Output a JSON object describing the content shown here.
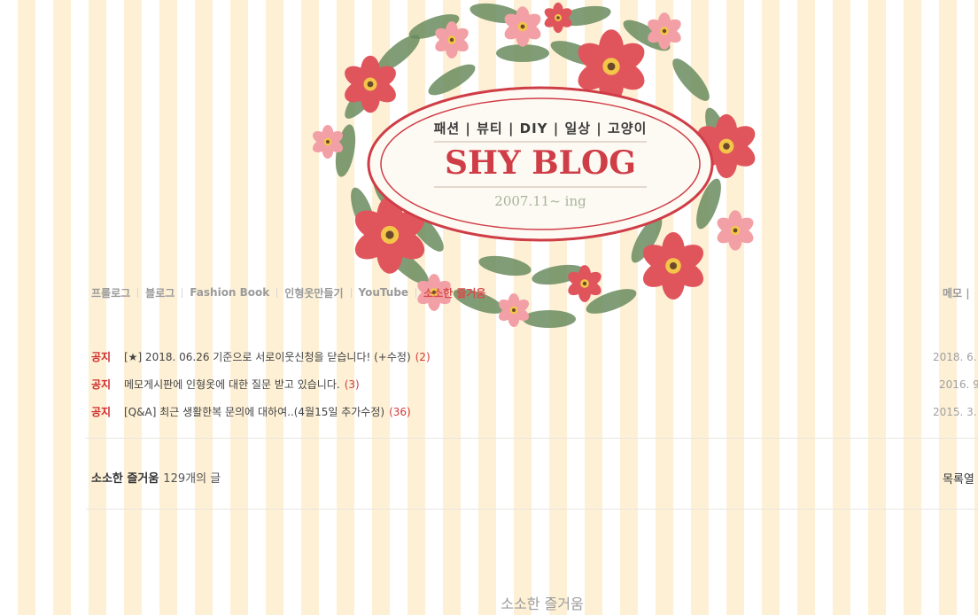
{
  "banner": {
    "categories": "패션 | 뷰티 | DIY | 일상 | 고양이",
    "title": "SHY BLOG",
    "date": "2007.11~ ing",
    "colors": {
      "title": "#cf3d47",
      "flower_main": "#e0555c",
      "flower_light": "#f2a0a6",
      "leaf": "#6b8c5f"
    }
  },
  "nav": {
    "items": [
      "프롤로그",
      "블로그",
      "Fashion Book",
      "인형옷만들기",
      "YouTube",
      "소소한 즐거움"
    ],
    "active_index": 5,
    "right_item": "메모 |"
  },
  "notices": [
    {
      "tag": "공지",
      "title": "[★] 2018. 06.26 기준으로 서로이웃신청을 닫습니다! (+수정)",
      "count": "(2)",
      "date": "2018. 6."
    },
    {
      "tag": "공지",
      "title": "메모게시판에 인형옷에 대한 질문 받고 있습니다.",
      "count": "(3)",
      "date": "2016. 9"
    },
    {
      "tag": "공지",
      "title": "[Q&A] 최근 생활한복 문의에 대하여..(4월15일 추가수정)",
      "count": "(36)",
      "date": "2015. 3."
    }
  ],
  "list_header": {
    "category": "소소한 즐거움",
    "count": "129개의 글",
    "toggle": "목록열"
  },
  "footer": {
    "category_title": "소소한 즐거움"
  }
}
